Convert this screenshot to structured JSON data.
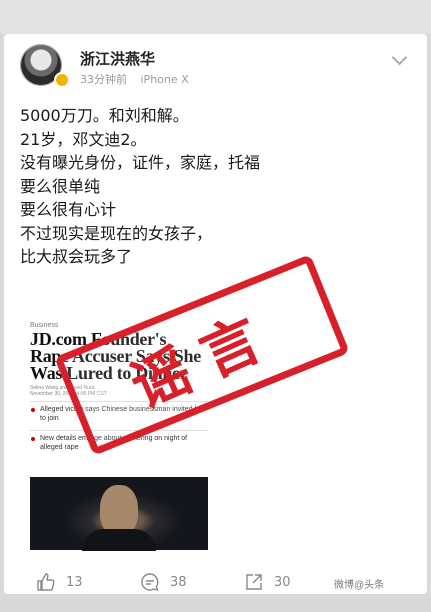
{
  "post": {
    "author": "浙江洪燕华",
    "time": "33分钟前",
    "device": "iPhone X",
    "lines": [
      "5000万刀。和刘和解。",
      "21岁，邓文迪2。",
      "没有曝光身份，证件，家庭，托福",
      "要么很单纯",
      "要么很有心计",
      "不过现实是现在的女孩子，",
      "比大叔会玩多了"
    ]
  },
  "article": {
    "section": "Business",
    "headline": "JD.com Founder's Rape Accuser Says She Was Lured to Dinner",
    "byline": "Selina Wang and David Ruck",
    "date": "November 30, 2018, 4:00 PM CST",
    "bullets": [
      "Alleged victim says Chinese businessman invited her to join",
      "New details emerge about gathering on night of alleged rape"
    ]
  },
  "stamp": {
    "text": "谣言",
    "color": "#d8202a"
  },
  "actions": {
    "like_count": "13",
    "comment_count": "38",
    "share_count": "30"
  },
  "watermark": "微博@头条"
}
